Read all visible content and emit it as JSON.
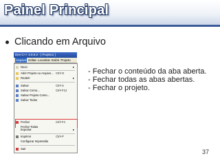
{
  "slide": {
    "title": "Painel Principal",
    "bullet": "Clicando em Arquivo",
    "descriptions": [
      "- Fechar o conteúdo da aba aberta.",
      "- Fechar todas as abas abertas.",
      "- Fechar o projeto."
    ],
    "page_number": "37"
  },
  "ide": {
    "window_title": "Dev-C++ 4.9.9.2 - [ Projeto1 ]",
    "menus": [
      "Arquivo",
      "Editar",
      "Localizar",
      "Exibir",
      "Projeto"
    ],
    "items": {
      "novo": {
        "label": "Novo",
        "shortcut": ""
      },
      "abrir": {
        "label": "Abrir Projeto ou Arquivo...",
        "shortcut": "Ctrl+O"
      },
      "reabrir": {
        "label": "Reabrir",
        "shortcut": ""
      },
      "salvar": {
        "label": "Salvar",
        "shortcut": "Ctrl+S"
      },
      "salvar_como": {
        "label": "Salvar Como...",
        "shortcut": "Ctrl+F12"
      },
      "salvar_projeto_como": {
        "label": "Salvar Projeto Como...",
        "shortcut": ""
      },
      "salvar_todos": {
        "label": "Salvar Todos",
        "shortcut": ""
      },
      "fechar": {
        "label": "Fechar",
        "shortcut": "Ctrl+F4"
      },
      "fechar_todas": {
        "label": "Fechar Todas",
        "shortcut": ""
      },
      "fechar_projeto": {
        "label": "Fechar Projeto",
        "shortcut": ""
      },
      "propriedades": {
        "label": "Propriedades",
        "shortcut": ""
      },
      "importar": {
        "label": "Importar",
        "shortcut": ""
      },
      "exportar": {
        "label": "Exportar",
        "shortcut": ""
      },
      "imprimir": {
        "label": "Imprimir",
        "shortcut": "Ctrl+P"
      },
      "configurar_impressao": {
        "label": "Configurar Impressão",
        "shortcut": ""
      },
      "sair": {
        "label": "Sair",
        "shortcut": ""
      }
    }
  },
  "colors": {
    "title_text": "#ffffff",
    "title_outline": "#1e3561",
    "highlight_border": "#e03c3c",
    "menu_bg": "#f7f7f2"
  }
}
